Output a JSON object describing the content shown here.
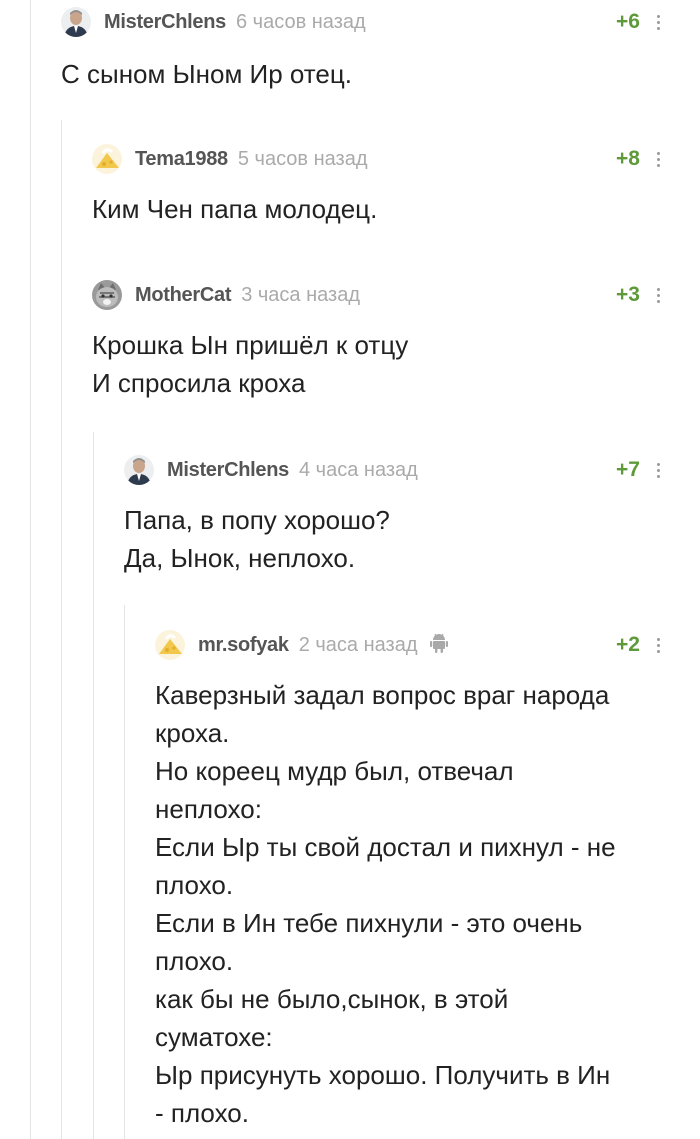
{
  "colors": {
    "rating": "#5f9a3a",
    "author": "#555555",
    "time": "#aaaaaa",
    "text": "#222222",
    "thread_line": "#e4e4e4"
  },
  "comments": [
    {
      "author": "MisterChlens",
      "time": "6 часов назад",
      "rating": "+6",
      "avatar": "man-avatar",
      "lines": [
        "С сыном Ыном Ир отец."
      ]
    },
    {
      "author": "Tema1988",
      "time": "5 часов назад",
      "rating": "+8",
      "avatar": "cheese-avatar",
      "lines": [
        "Ким Чен папа молодец."
      ]
    },
    {
      "author": "MotherCat",
      "time": "3 часа назад",
      "rating": "+3",
      "avatar": "cat-avatar",
      "lines": [
        "Крошка Ын пришёл к отцу",
        "И спросила кроха"
      ]
    },
    {
      "author": "MisterChlens",
      "time": "4 часа назад",
      "rating": "+7",
      "avatar": "man-avatar",
      "lines": [
        "Папа, в попу хорошо?",
        "Да, Ынок, неплохо."
      ]
    },
    {
      "author": "mr.sofyak",
      "time": "2 часа назад",
      "rating": "+2",
      "avatar": "cheese-avatar",
      "platform_icon": "android-icon",
      "lines": [
        "Каверзный задал вопрос враг народа",
        "кроха.",
        "Но кореец мудр был, отвечал",
        "неплохо:",
        "Если Ыр ты свой достал и пихнул - не",
        "плохо.",
        "Если в Ин тебе пихнули - это очень",
        "плохо.",
        "как бы не было,сынок, в этой",
        "суматохе:",
        "Ыр присунуть хорошо. Получить в Ин",
        "- плохо."
      ]
    }
  ]
}
